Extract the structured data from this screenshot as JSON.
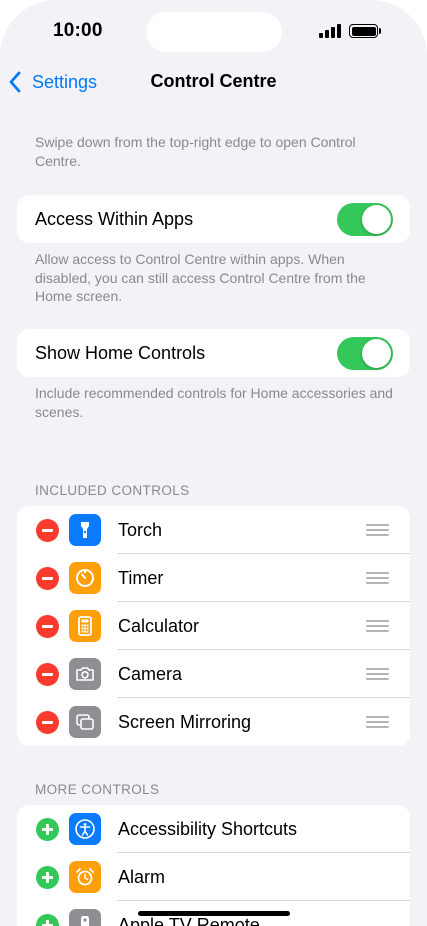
{
  "status_bar": {
    "time": "10:00"
  },
  "nav": {
    "back_label": "Settings",
    "title": "Control Centre"
  },
  "intro_footnote": "Swipe down from the top-right edge to open Control Centre.",
  "access_within_apps": {
    "label": "Access Within Apps",
    "on": true,
    "footnote": "Allow access to Control Centre within apps. When disabled, you can still access Control Centre from the Home screen."
  },
  "show_home_controls": {
    "label": "Show Home Controls",
    "on": true,
    "footnote": "Include recommended controls for Home accessories and scenes."
  },
  "included_controls": {
    "header": "INCLUDED CONTROLS",
    "items": [
      {
        "label": "Torch",
        "icon": "torch-icon",
        "color": "#0a7aff"
      },
      {
        "label": "Timer",
        "icon": "timer-icon",
        "color": "#ff9f0a"
      },
      {
        "label": "Calculator",
        "icon": "calculator-icon",
        "color": "#ff9f0a"
      },
      {
        "label": "Camera",
        "icon": "camera-icon",
        "color": "#8e8e93"
      },
      {
        "label": "Screen Mirroring",
        "icon": "screen-mirroring-icon",
        "color": "#8e8e93"
      }
    ]
  },
  "more_controls": {
    "header": "MORE CONTROLS",
    "items": [
      {
        "label": "Accessibility Shortcuts",
        "icon": "accessibility-icon",
        "color": "#0a7aff"
      },
      {
        "label": "Alarm",
        "icon": "alarm-icon",
        "color": "#ff9f0a"
      },
      {
        "label": "Apple TV Remote",
        "icon": "remote-icon",
        "color": "#8e8e93"
      }
    ]
  },
  "colors": {
    "accent": "#007aff",
    "switch_on": "#34c759",
    "remove": "#ff3b30",
    "add": "#34c759"
  }
}
